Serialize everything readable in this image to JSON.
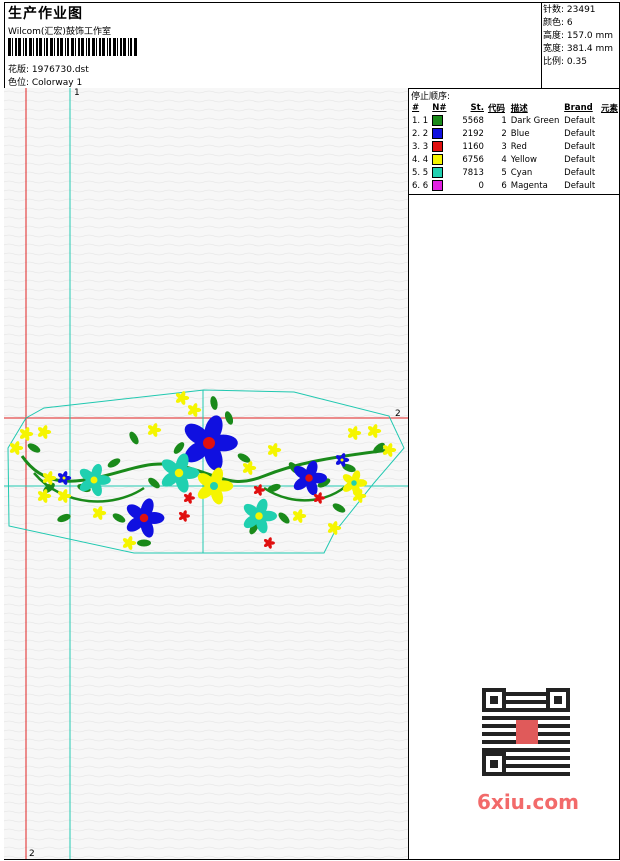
{
  "header": {
    "title": "生产作业图",
    "company": "Wilcom(汇宏)鼓饰工作室",
    "design_label": "花版: 1976730.dst",
    "colorway_label": "色位: Colorway 1"
  },
  "stats": {
    "stitches": "针数: 23491",
    "colors": "颜色: 6",
    "height": "高度: 157.0 mm",
    "width": "宽度: 381.4 mm",
    "scale": "比例: 0.35"
  },
  "stop_sequence": {
    "title": "停止顺序:",
    "headers": [
      "#",
      "N#",
      "St.",
      "代码",
      "描述",
      "Brand",
      "元素"
    ],
    "rows": [
      {
        "idx": "1. 1",
        "color": "#1a8a1a",
        "st": "5568",
        "code": "1",
        "desc": "Dark Green",
        "brand": "Default"
      },
      {
        "idx": "2. 2",
        "color": "#1010e0",
        "st": "2192",
        "code": "2",
        "desc": "Blue",
        "brand": "Default"
      },
      {
        "idx": "3. 3",
        "color": "#e01010",
        "st": "1160",
        "code": "3",
        "desc": "Red",
        "brand": "Default"
      },
      {
        "idx": "4. 4",
        "color": "#f5f500",
        "st": "6756",
        "code": "4",
        "desc": "Yellow",
        "brand": "Default"
      },
      {
        "idx": "5. 5",
        "color": "#20d0b0",
        "st": "7813",
        "code": "5",
        "desc": "Cyan",
        "brand": "Default"
      },
      {
        "idx": "6. 6",
        "color": "#e020e0",
        "st": "0",
        "code": "6",
        "desc": "Magenta",
        "brand": "Default"
      }
    ]
  },
  "guides": {
    "v1_label": "1",
    "h_label": "2",
    "v2_label": "2"
  },
  "watermark": {
    "text": "6xiu.com",
    "icon": "qr-code-icon"
  }
}
